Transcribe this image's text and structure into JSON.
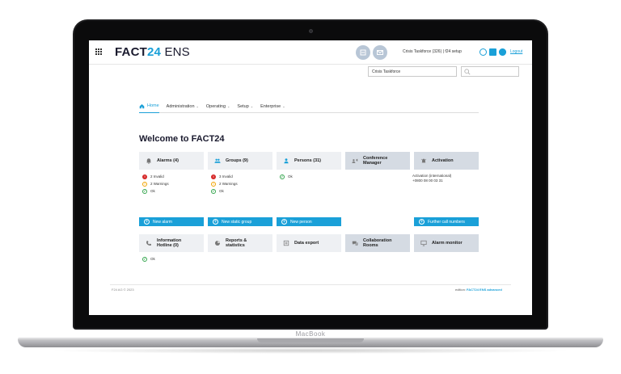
{
  "device": {
    "brand_label": "MacBook"
  },
  "header": {
    "logo_main": "FACT",
    "logo_accent": "24",
    "logo_suffix": "ENS",
    "user_label": "Crisis Taskforce (326) | f24 setup",
    "logout_label": "Logout",
    "org_select_value": "Crisis Taskforce",
    "search_placeholder": ""
  },
  "nav": {
    "home": "Home",
    "administration": "Administration",
    "operating": "Operating",
    "setup": "Setup",
    "enterprise": "Enterprise"
  },
  "main": {
    "title": "Welcome to FACT24",
    "tiles_row1": [
      {
        "label": "Alarms (4)",
        "icon": "bell-icon"
      },
      {
        "label": "Groups (9)",
        "icon": "group-icon"
      },
      {
        "label": "Persons (31)",
        "icon": "person-icon"
      },
      {
        "label": "Conference Manager",
        "icon": "conference-icon"
      },
      {
        "label": "Activation",
        "icon": "bell-ring-icon"
      }
    ],
    "alarms_status": [
      "2 Invalid",
      "2 Warnings",
      "Ok"
    ],
    "groups_status": [
      "3 Invalid",
      "2 Warnings",
      "Ok"
    ],
    "persons_status": [
      "Ok"
    ],
    "activation_info": [
      "Activation (international)",
      "+0800 08 00 03 31"
    ],
    "buttons": {
      "new_alarm": "New alarm",
      "new_static_group": "New static group",
      "new_person": "New person",
      "further_call_numbers": "Further call numbers"
    },
    "tiles_row2": [
      {
        "label": "Information Hotline (0)",
        "icon": "phone-info-icon"
      },
      {
        "label": "Reports & statistics",
        "icon": "pie-chart-icon"
      },
      {
        "label": "Data export",
        "icon": "export-icon"
      },
      {
        "label": "Collaboration Rooms",
        "icon": "chat-icon"
      },
      {
        "label": "Alarm monitor",
        "icon": "monitor-icon"
      }
    ],
    "hotline_status": [
      "Ok"
    ]
  },
  "footer": {
    "copyright": "F24 AG © 2023",
    "edition_prefix": "edition:",
    "edition_name": "FACT24 ENS advanced"
  },
  "colors": {
    "accent": "#1aa0d8",
    "tile": "#eef0f3",
    "tile_dark": "#d5dbe3",
    "error": "#d62828",
    "warning": "#f2a400",
    "ok": "#36a64f"
  }
}
